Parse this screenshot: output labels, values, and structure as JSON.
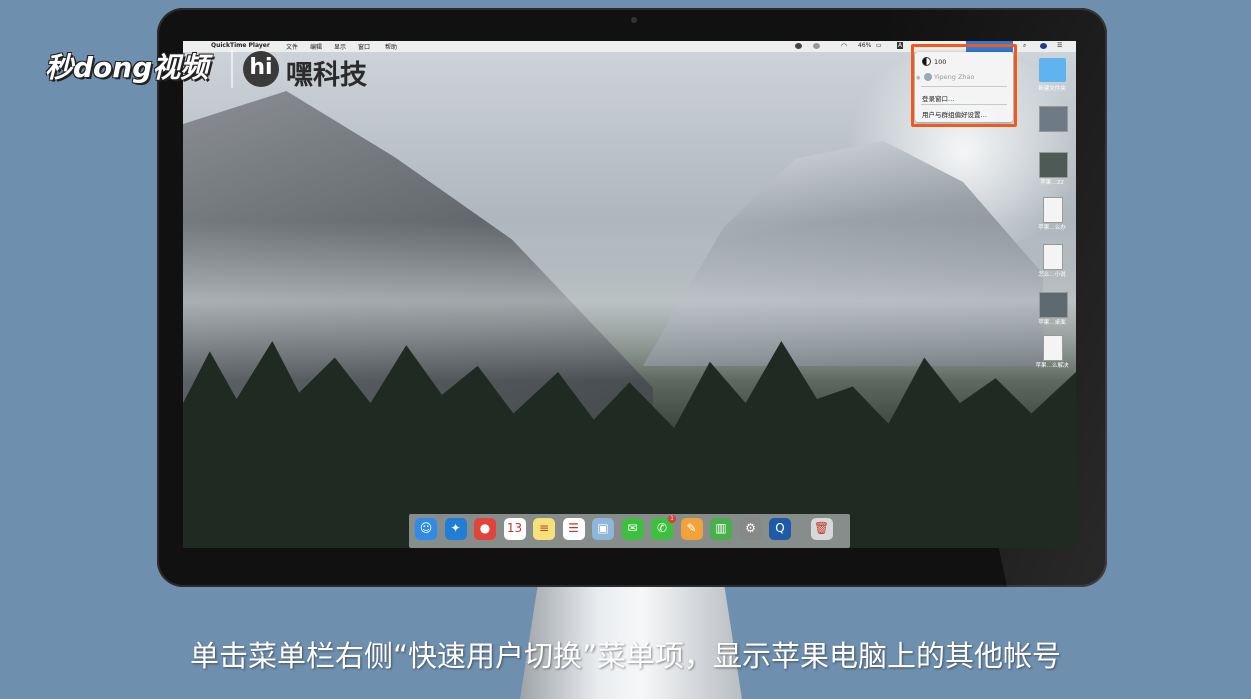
{
  "overlay": {
    "brand_logo": "秒dong视频",
    "brand_hi": "hi",
    "brand_name": "嘿科技",
    "subtitle": "单击菜单栏右侧“快速用户切换”菜单项，显示苹果电脑上的其他帐号"
  },
  "menubar": {
    "apple": "",
    "app_name": "QuickTime Player",
    "items": [
      "文件",
      "编辑",
      "显示",
      "窗口",
      "帮助"
    ],
    "battery": "46%",
    "input_indicator": "A"
  },
  "user_menu": {
    "users": [
      {
        "name": "100",
        "active": true
      },
      {
        "name": "Yipeng Zhao",
        "active": false
      }
    ],
    "actions": [
      "登录窗口…",
      "用户与群组偏好设置…"
    ]
  },
  "desktop_icons": [
    {
      "caption": "新建文件夹"
    },
    {
      "caption": ""
    },
    {
      "caption": "苹果…22"
    },
    {
      "caption": "苹果…么办"
    },
    {
      "caption": "怎么…小说"
    },
    {
      "caption": "苹果…桌面"
    },
    {
      "caption": "苹果…么解决"
    }
  ],
  "dock": {
    "items": [
      {
        "name": "finder",
        "color": "#2f8be6",
        "glyph": "☺"
      },
      {
        "name": "safari",
        "color": "#1f7ed6",
        "glyph": "✦"
      },
      {
        "name": "chrome",
        "color": "#e0443a",
        "glyph": "●"
      },
      {
        "name": "calendar",
        "color": "#ffffff",
        "glyph": "13"
      },
      {
        "name": "notes",
        "color": "#f5e27a",
        "glyph": "≡"
      },
      {
        "name": "reminders",
        "color": "#ffffff",
        "glyph": "☰"
      },
      {
        "name": "preview",
        "color": "#8fb6d9",
        "glyph": "▣"
      },
      {
        "name": "wechat",
        "color": "#3fbf3f",
        "glyph": "✉"
      },
      {
        "name": "facetime",
        "color": "#3fbf3f",
        "glyph": "✆"
      },
      {
        "name": "pages",
        "color": "#f2a23a",
        "glyph": "✎"
      },
      {
        "name": "numbers",
        "color": "#48b04a",
        "glyph": "▥"
      },
      {
        "name": "system-preferences",
        "color": "#888888",
        "glyph": "⚙"
      },
      {
        "name": "quicktime",
        "color": "#1e5aa8",
        "glyph": "Q"
      },
      {
        "name": "trash",
        "color": "#d6d8da",
        "glyph": "🗑"
      }
    ],
    "badge": "1"
  }
}
